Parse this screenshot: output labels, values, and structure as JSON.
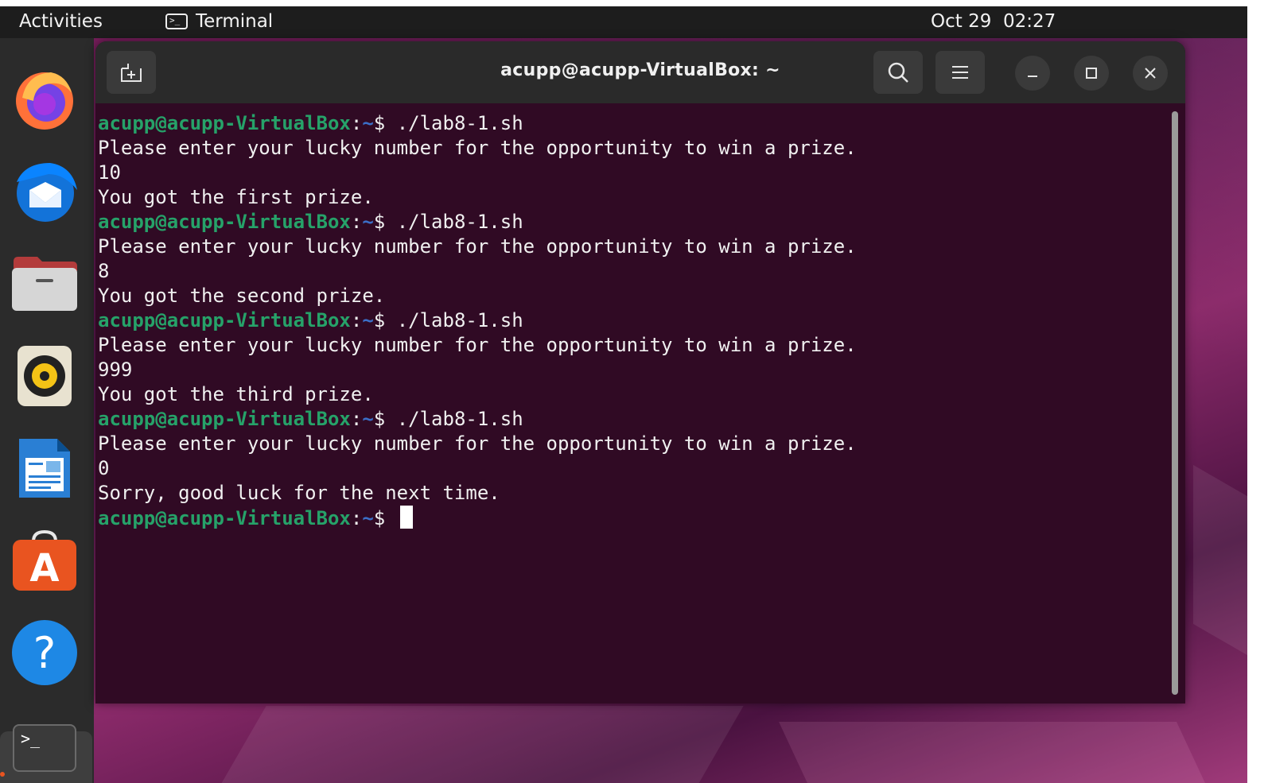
{
  "topbar": {
    "activities": "Activities",
    "app_name": "Terminal",
    "app_icon_glyph": ">_",
    "date": "Oct 29",
    "time": "02:27"
  },
  "dock": {
    "items": [
      {
        "name": "firefox",
        "icon": "firefox-icon"
      },
      {
        "name": "thunderbird",
        "icon": "thunderbird-icon"
      },
      {
        "name": "files",
        "icon": "files-icon"
      },
      {
        "name": "rhythmbox",
        "icon": "rhythmbox-icon"
      },
      {
        "name": "libreoffice-writer",
        "icon": "writer-icon"
      },
      {
        "name": "app-center",
        "icon": "app-center-icon"
      },
      {
        "name": "help",
        "icon": "help-icon"
      },
      {
        "name": "terminal",
        "icon": "terminal-icon",
        "glyph": ">_"
      }
    ],
    "help_glyph": "?",
    "appcenter_glyph": "A"
  },
  "window": {
    "title": "acupp@acupp-VirtualBox: ~"
  },
  "terminal": {
    "user_host": "acupp@acupp-VirtualBox",
    "colon": ":",
    "path": "~",
    "prompt_char": "$",
    "lines": [
      {
        "type": "prompt",
        "cmd": " ./lab8-1.sh"
      },
      {
        "type": "output",
        "text": "Please enter your lucky number for the opportunity to win a prize."
      },
      {
        "type": "output",
        "text": "10"
      },
      {
        "type": "output",
        "text": "You got the first prize."
      },
      {
        "type": "prompt",
        "cmd": " ./lab8-1.sh"
      },
      {
        "type": "output",
        "text": "Please enter your lucky number for the opportunity to win a prize."
      },
      {
        "type": "output",
        "text": "8"
      },
      {
        "type": "output",
        "text": "You got the second prize."
      },
      {
        "type": "prompt",
        "cmd": " ./lab8-1.sh"
      },
      {
        "type": "output",
        "text": "Please enter your lucky number for the opportunity to win a prize."
      },
      {
        "type": "output",
        "text": "999"
      },
      {
        "type": "output",
        "text": "You got the third prize."
      },
      {
        "type": "prompt",
        "cmd": " ./lab8-1.sh"
      },
      {
        "type": "output",
        "text": "Please enter your lucky number for the opportunity to win a prize."
      },
      {
        "type": "output",
        "text": "0"
      },
      {
        "type": "output",
        "text": "Sorry, good luck for the next time."
      },
      {
        "type": "prompt",
        "cmd": " ",
        "cursor": true
      }
    ]
  },
  "colors": {
    "terminal_bg": "#300a24",
    "prompt_user": "#26a269",
    "prompt_path": "#3b6fc8",
    "accent": "#e95420"
  }
}
